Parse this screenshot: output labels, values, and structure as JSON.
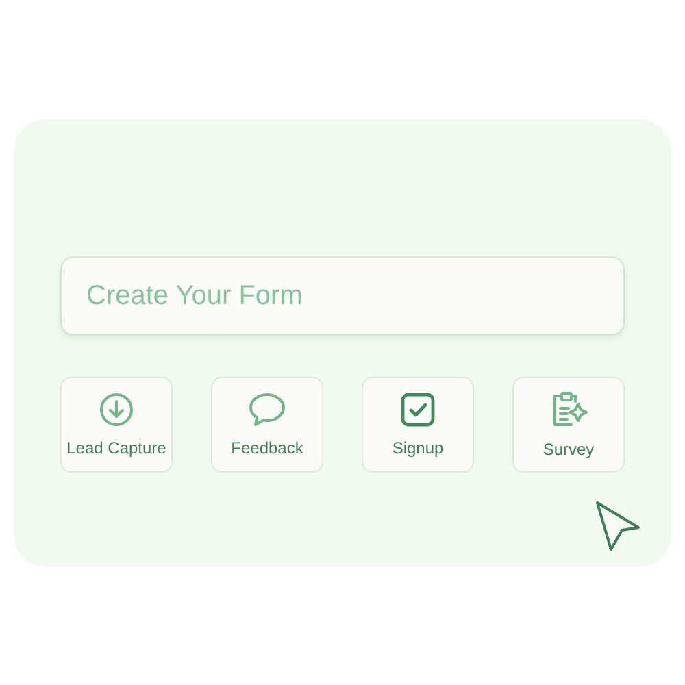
{
  "form_name": {
    "placeholder": "Create Your Form"
  },
  "templates": [
    {
      "kind": "download",
      "label": "Lead Capture"
    },
    {
      "kind": "chat",
      "label": "Feedback"
    },
    {
      "kind": "check",
      "label": "Signup"
    },
    {
      "kind": "clipboard",
      "label": "Survey"
    }
  ]
}
